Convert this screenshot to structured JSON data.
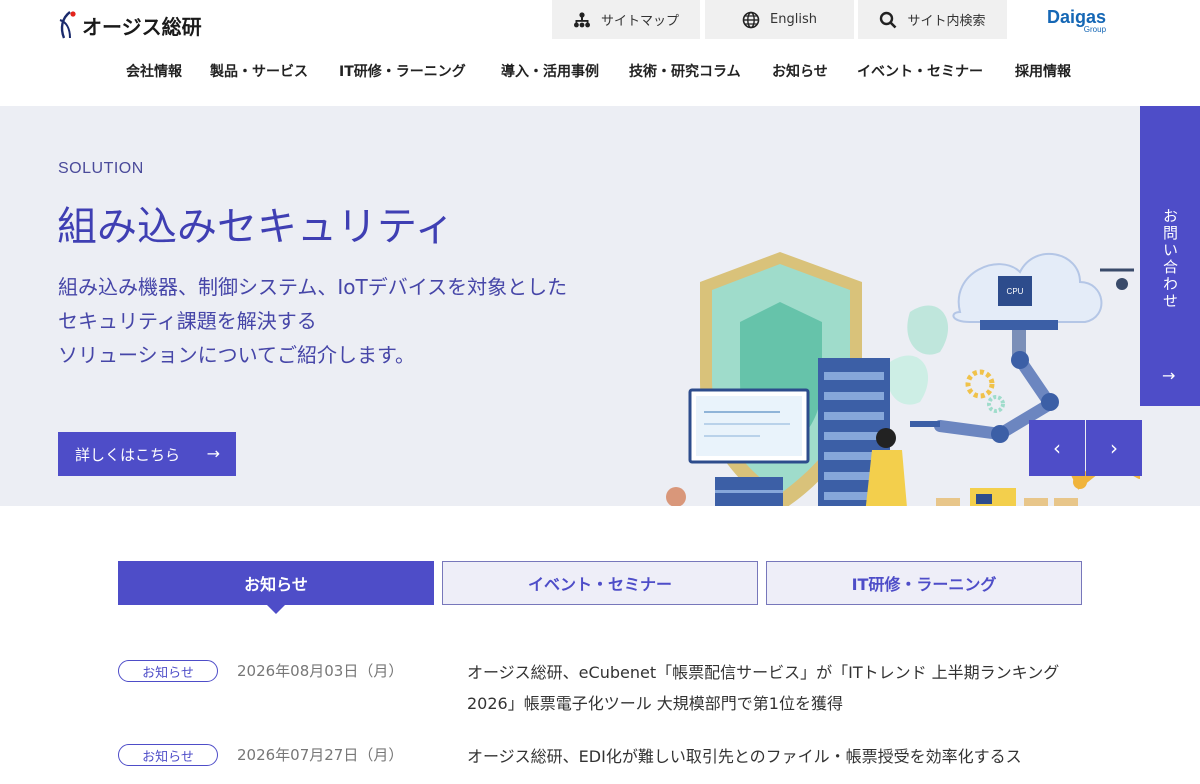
{
  "header": {
    "logo_text": "オージス総研",
    "utility": [
      {
        "label": "サイトマップ",
        "icon": "sitemap-icon"
      },
      {
        "label": "English",
        "icon": "globe-icon"
      },
      {
        "label": "サイト内検索",
        "icon": "search-icon"
      }
    ],
    "group_logo": "Daigas",
    "group_logo_sub": "Group",
    "nav": [
      "会社情報",
      "製品・サービス",
      "IT研修・ラーニング",
      "導入・活用事例",
      "技術・研究コラム",
      "お知らせ",
      "イベント・セミナー",
      "採用情報"
    ]
  },
  "hero": {
    "label": "SOLUTION",
    "title": "組み込みセキュリティ",
    "description": "組み込み機器、制御システム、IoTデバイスを対象とした\nセキュリティ課題を解決する\nソリューションについてご紹介します。",
    "cta_label": "詳しくはこちら",
    "contact_label": "お問い合わせ",
    "illustration_cpu_label": "CPU"
  },
  "tabs": [
    {
      "label": "お知らせ",
      "active": true
    },
    {
      "label": "イベント・セミナー",
      "active": false
    },
    {
      "label": "IT研修・ラーニング",
      "active": false
    }
  ],
  "news": [
    {
      "badge": "お知らせ",
      "date": "2026年08月03日（月）",
      "title": "オージス総研、eCubenet「帳票配信サービス」が「ITトレンド 上半期ランキング2026」帳票電子化ツール 大規模部門で第1位を獲得"
    },
    {
      "badge": "お知らせ",
      "date": "2026年07月27日（月）",
      "title": "オージス総研、EDI化が難しい取引先とのファイル・帳票授受を効率化するス"
    }
  ],
  "colors": {
    "accent": "#4e4dc8",
    "hero_bg": "#eceef4",
    "tab_inactive_bg": "#eeeef8",
    "brand_blue": "#1567b5"
  }
}
